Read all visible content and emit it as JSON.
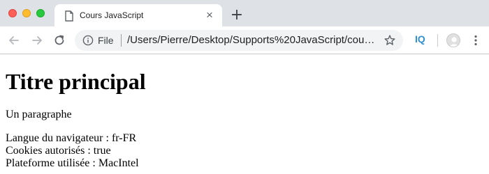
{
  "window": {
    "controls": [
      "close",
      "minimize",
      "zoom"
    ]
  },
  "tab": {
    "title": "Cours JavaScript",
    "close_label": "×",
    "new_tab_label": "+"
  },
  "toolbar": {
    "scheme_label": "File",
    "url": "/Users/Pierre/Desktop/Supports%20JavaScript/cour...",
    "extension_label": "IQ"
  },
  "page": {
    "title": "Titre principal",
    "paragraph": "Un paragraphe",
    "info_lines": [
      "Langue du navigateur : fr-FR",
      "Cookies autorisés : true",
      "Plateforme utilisée : MacIntel"
    ]
  },
  "colors": {
    "tabstrip_bg": "#dee1e6",
    "omnibox_bg": "#f1f3f4",
    "extension_accent": "#2f8fd0",
    "traffic_red": "#fe5f57",
    "traffic_yellow": "#febc2e",
    "traffic_green": "#28c840"
  },
  "icons": [
    "page-icon",
    "close-icon",
    "plus-icon",
    "back-arrow-icon",
    "forward-arrow-icon",
    "reload-icon",
    "info-icon",
    "star-icon",
    "avatar-icon",
    "kebab-menu-icon"
  ]
}
